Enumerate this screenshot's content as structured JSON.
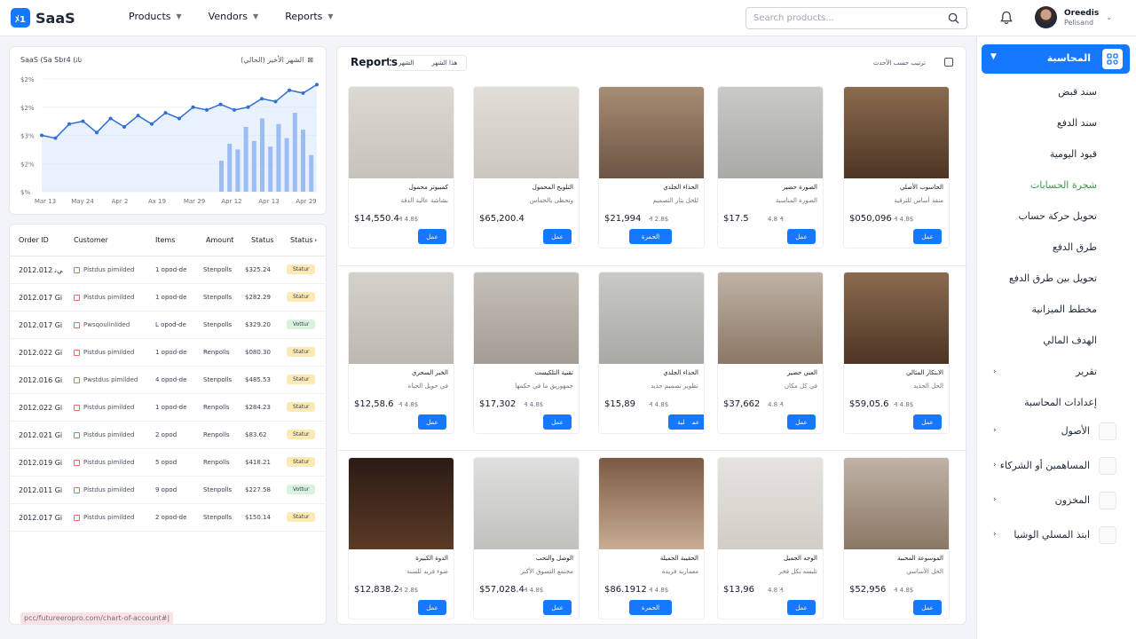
{
  "header": {
    "logo_mark": "ﾒ1",
    "logo_text": "SaaS",
    "nav": [
      {
        "label": "Products"
      },
      {
        "label": "Vendors"
      },
      {
        "label": "Reports"
      }
    ],
    "search_placeholder": "Search products...",
    "user_name": "Oreedis",
    "user_role": "Pelisand"
  },
  "chart_card": {
    "title": "SaaS (Sa Sbr4 (ﺗﺎﺛ",
    "filter": "اﻟﺸﻬﺮ اﻷﺧﻴﺮ (اﻟﺤﺎﻟﻲ)"
  },
  "chart_data": {
    "type": "line",
    "x": [
      "Mar 13",
      "May 24",
      "Apr 2",
      "Ax 19",
      "Mar 29",
      "Apr 12",
      "Apr 13",
      "Apr 29"
    ],
    "series": [
      {
        "values": [
          3.0,
          2.9,
          3.4,
          3.5,
          3.1,
          3.6,
          3.3,
          3.7,
          3.4,
          3.8,
          3.6,
          4.0,
          3.9,
          4.1,
          3.9,
          4.0,
          4.3,
          4.2,
          4.6,
          4.5,
          4.8
        ]
      }
    ],
    "bars": [
      1.1,
      1.7,
      1.5,
      2.3,
      1.8,
      2.6,
      1.6,
      2.4,
      1.9,
      2.8,
      2.2,
      1.3
    ],
    "y_ticks": [
      "$2%",
      "$2%",
      "$3%",
      "$2%",
      "$%"
    ],
    "grid": true,
    "colors": {
      "line": "#2f6fd6",
      "bar": "#1f66e0",
      "area": "#dbe8fb"
    }
  },
  "orders": {
    "columns": [
      "Order ID",
      "Customer",
      "Items",
      "Amount",
      "Status",
      "Status"
    ],
    "rows": [
      {
        "id": "2012.012 ﻲﻧ",
        "customer": "Pistdus pimilded",
        "items": "1 opod-de",
        "method": "Stenpolls",
        "amount": "$325.24",
        "status": "Statur",
        "tone": "yellow"
      },
      {
        "id": "2012.017 Gi",
        "customer": "Pistdus pimilded",
        "items": "1 opod-de",
        "method": "Stenpolls",
        "amount": "$282.29",
        "status": "Statur",
        "tone": "yellow"
      },
      {
        "id": "2012.017 Gi",
        "customer": "Pwsqoulinlided",
        "items": "L opod-de",
        "method": "Stenpolls",
        "amount": "$329.20",
        "status": "Vottur",
        "tone": "green"
      },
      {
        "id": "2012.022 Gi",
        "customer": "Pistdus pimilded",
        "items": "1 opod-de",
        "method": "Renpolls",
        "amount": "$080.30",
        "status": "Statur",
        "tone": "yellow"
      },
      {
        "id": "2012.016 Gi",
        "customer": "Pwstdus pimilded",
        "items": "4 opod-de",
        "method": "Stenpolls",
        "amount": "$485.53",
        "status": "Statur",
        "tone": "yellow"
      },
      {
        "id": "2012.022 Gi",
        "customer": "Pistdus pimilded",
        "items": "1 opod-de",
        "method": "Renpolls",
        "amount": "$284.23",
        "status": "Statur",
        "tone": "yellow"
      },
      {
        "id": "2012.021 Gi",
        "customer": "Pistdus pimilded",
        "items": "2 opod",
        "method": "Renpolls",
        "amount": "$83.62",
        "status": "Statur",
        "tone": "yellow"
      },
      {
        "id": "2012.019 Gi",
        "customer": "Pistdus pimilded",
        "items": "5 opod",
        "method": "Renpolls",
        "amount": "$418.21",
        "status": "Statur",
        "tone": "yellow"
      },
      {
        "id": "2012.011 Gi",
        "customer": "Pistdus pimilded",
        "items": "9 opod",
        "method": "Stenpolls",
        "amount": "$227.58",
        "status": "Vottur",
        "tone": "green"
      },
      {
        "id": "2012.017 Gi",
        "customer": "Pistdus pimilded",
        "items": "2 opod-de",
        "method": "Stenpolls",
        "amount": "$150.14",
        "status": "Statur",
        "tone": "yellow"
      }
    ],
    "url": "pcc/futureeropro.com/chart-of-account#|"
  },
  "reports": {
    "title": "Reports",
    "filters": [
      "اﻟﺸﻬﺮ",
      "ﻫﺬا اﻟﺸﻬﺮ"
    ],
    "sort_label": "ﺗﺮﺗﻴﺐ ﺣﺴﺐ اﻷﺣﺪث"
  },
  "products": [
    {
      "name": "ﻛﻤﺒﻴﻮﺗﺮ ﻣﺤﻤﻮل",
      "desc": "ﺑﺸﺎﺷﺔ ﻋﺎﻟﻴﺔ اﻟﺪﻗﺔ",
      "price": "$14,550.4",
      "old": "₰ 4.8$",
      "btn": "ﻋﻤﻞ",
      "bg": "bg-laptop-purple"
    },
    {
      "name": "اﻟﺘﻠﻮﻳﺢ اﻟﻤﺤﻤﻮل",
      "desc": "وﺗﺤﻈﻰ ﺑﺎﻟﺤﻤﺎس",
      "price": "$65,200.4",
      "old": "",
      "btn": "ﻋﻤﻞ",
      "bg": "bg-laptop-blue"
    },
    {
      "name": "اﻟﺤﺬاء اﻟﺠﻠﺪي",
      "desc": "ﻟﻠﺤﻞ ﺑﺘﺎر اﻟﺘﺼﻤﻴﻢ",
      "price": "$21,994",
      "old": "₰ 2.8$",
      "btn": "اﻟﺤﻤﺮة",
      "wide": true,
      "bg": "bg-shoes"
    },
    {
      "name": "اﻟﺼﻮرة ﺣﻀﻴﺮ",
      "desc": "اﻟﺼﻮرة اﻟﻤﻨﺎﺳﺒﺔ",
      "price": "$17.5",
      "old": "4.8 ₰",
      "btn": "ﻋﻤﻞ",
      "bg": "bg-grey"
    },
    {
      "name": "اﻟﺤﺎﺳﻮب اﻷﺻﻠﻲ",
      "desc": "ﻣﻨﻔﺬ أﺳﺎس ﻟﻠﺘﺮﻗﻴﺔ",
      "price": "$050,096",
      "old": "₰ 4.8$",
      "btn": "ﻋﻤﻞ",
      "bg": "bg-warm"
    },
    {
      "name": "اﻟﺨﺒﺮ اﻟﺴﺤﺮي",
      "desc": "ﻓﻲ ﺣﻮﻳﻞ اﻟﺤﻴﺎة",
      "price": "$12,58.6",
      "old": "₰ 4.8$",
      "btn": "ﻋﻤﻞ",
      "bg": "bg-printer"
    },
    {
      "name": "ﺗﻘﻨﻴﺔ اﻟﺘﻠﻜﻴﺴﺖ",
      "desc": "ﺟﻤﻬﻮرﻳﻖ ﻣﺎ ﻓﻲ ﺣﻜﻤﻬﺎ",
      "price": "$17,302",
      "old": "₰ 4.8$",
      "btn": "ﻋﻤﻞ",
      "bg": "bg-dark"
    },
    {
      "name": "اﻟﺤﺬاء اﻟﺠﻠﺪي",
      "desc": "ﺗﻄﻮﻳﺮ ﺗﺼﻤﻴﻢ ﺟﺪﻳﺪ",
      "price": "$15,89",
      "old": "₰ 4.8$",
      "btn": "ﻗﻠﺒﺔ",
      "btn2": "ﻋﻤ",
      "bg": "bg-grey"
    },
    {
      "name": "اﻟﻌﻨﻲ ﺣﻀﻴﺮ",
      "desc": "ﻓﻲ ﻛﻞ ﻣﻜﺎن",
      "price": "$37,662",
      "old": "4.8 ₰",
      "btn": "ﻋﻤﻞ",
      "bg": "bg-mac"
    },
    {
      "name": "اﻻﺑﺘﻜﺎر اﻟﻤﺜﺎﻟﻲ",
      "desc": "اﻟﺤﻞ اﻟﺠﺪﻳﺪ",
      "price": "$59,05.6",
      "old": "₰ 4.8$",
      "btn": "ﻋﻤﻞ",
      "bg": "bg-warm"
    },
    {
      "name": "اﻟﺪوة اﻟﻜﺒﻴﺮة",
      "desc": "ﺿﻮء ﻓﺮﻳﺪ ﻟﻠﺴﻨﺔ",
      "price": "$12,838.2",
      "old": "₰ 2.8$",
      "btn": "ﻋﻤﻞ",
      "bg": "bg-fire"
    },
    {
      "name": "اﻟﻮﺻﻞ واﻟﺘﺤﺐ",
      "desc": "ﻣﺠﺘﻤﻊ اﻟﺘﺴﻮق اﻷﻛﺒﺮ",
      "price": "$57,028.4",
      "old": "₰ 4.8$",
      "btn": "ﻋﻤﻞ",
      "bg": "bg-box"
    },
    {
      "name": "اﻟﺤﻘﻴﺒﺔ اﻟﺠﻤﻴﻠﺔ",
      "desc": "ﻣﻌﻤﺎرﻳﺔ ﻓﺮﻳﺪة",
      "price": "$86.1912",
      "old": "₰ 4.8$",
      "btn": "اﻟﺤﻤﺮة",
      "wide": true,
      "bg": "bg-robe"
    },
    {
      "name": "اﻟﻮﺟﻪ اﻟﺠﻤﻴﻞ",
      "desc": "ﺗﻠﺒﺴﻪ ﺑﻜﻞ ﻓﺨﺮ",
      "price": "$13,96",
      "old": "4.8 ₰",
      "btn": "ﻋﻤﻞ",
      "bg": "bg-boot"
    },
    {
      "name": "اﻟﻤﻮﺳﻮﻋﺔ اﻟﻤﺤﺒﺒﺔ",
      "desc": "اﻟﺤﻞ اﻷﺳﺎﺳﻲ",
      "price": "$52,956",
      "old": "₰ 4.8$",
      "btn": "ﻋﻤﻞ",
      "bg": "bg-mac"
    }
  ],
  "sidebar": {
    "active": "اﻟﻤﺤﺎﺳﺒﺔ",
    "sub_items": [
      {
        "label": "ﺳﻨﺪ ﻗﺒﺾ",
        "hl": false,
        "chev": false
      },
      {
        "label": "ﺳﻨﺪ اﻟﺪﻓﻊ",
        "hl": false,
        "chev": false
      },
      {
        "label": "ﻗﻴﻮد اﻟﻴﻮﻣﻴﺔ",
        "hl": false,
        "chev": false
      },
      {
        "label": "ﺷﺠﺮة اﻟﺤﺴﺎﺑﺎت",
        "hl": true,
        "chev": false
      },
      {
        "label": "ﺗﺤﻮﻳﻞ ﺣﺮﻛﺔ ﺣﺴﺎب",
        "hl": false,
        "chev": false
      },
      {
        "label": "ﻃﺮق اﻟﺪﻓﻊ",
        "hl": false,
        "chev": false
      },
      {
        "label": "ﺗﺤﻮﻳﻞ ﺑﻴﻦ ﻃﺮق اﻟﺪﻓﻊ",
        "hl": false,
        "chev": false
      },
      {
        "label": "ﻣﺨﻄﻂ اﻟﻤﻴﺰاﻧﻴﺔ",
        "hl": false,
        "chev": false
      },
      {
        "label": "اﻟﻬﺪف اﻟﻤﺎﻟﻲ",
        "hl": false,
        "chev": false
      },
      {
        "label": "ﺗﻘﺮﻳﺮ",
        "hl": false,
        "chev": true
      },
      {
        "label": "إﻋﺪادات اﻟﻤﺤﺎﺳﺒﺔ",
        "hl": false,
        "chev": false
      }
    ],
    "main_items": [
      {
        "label": "اﻷﺻﻮل"
      },
      {
        "label": "اﻟﻤﺴﺎﻫﻤﻴﻦ أو اﻟﺸﺮﻛﺎء"
      },
      {
        "label": "اﻟﻤﺨﺰون"
      },
      {
        "label": "اﺑﺘﺬ اﻟﻤﺴﻠﻲ اﻟﻮﺷﻴﺎ"
      }
    ]
  }
}
